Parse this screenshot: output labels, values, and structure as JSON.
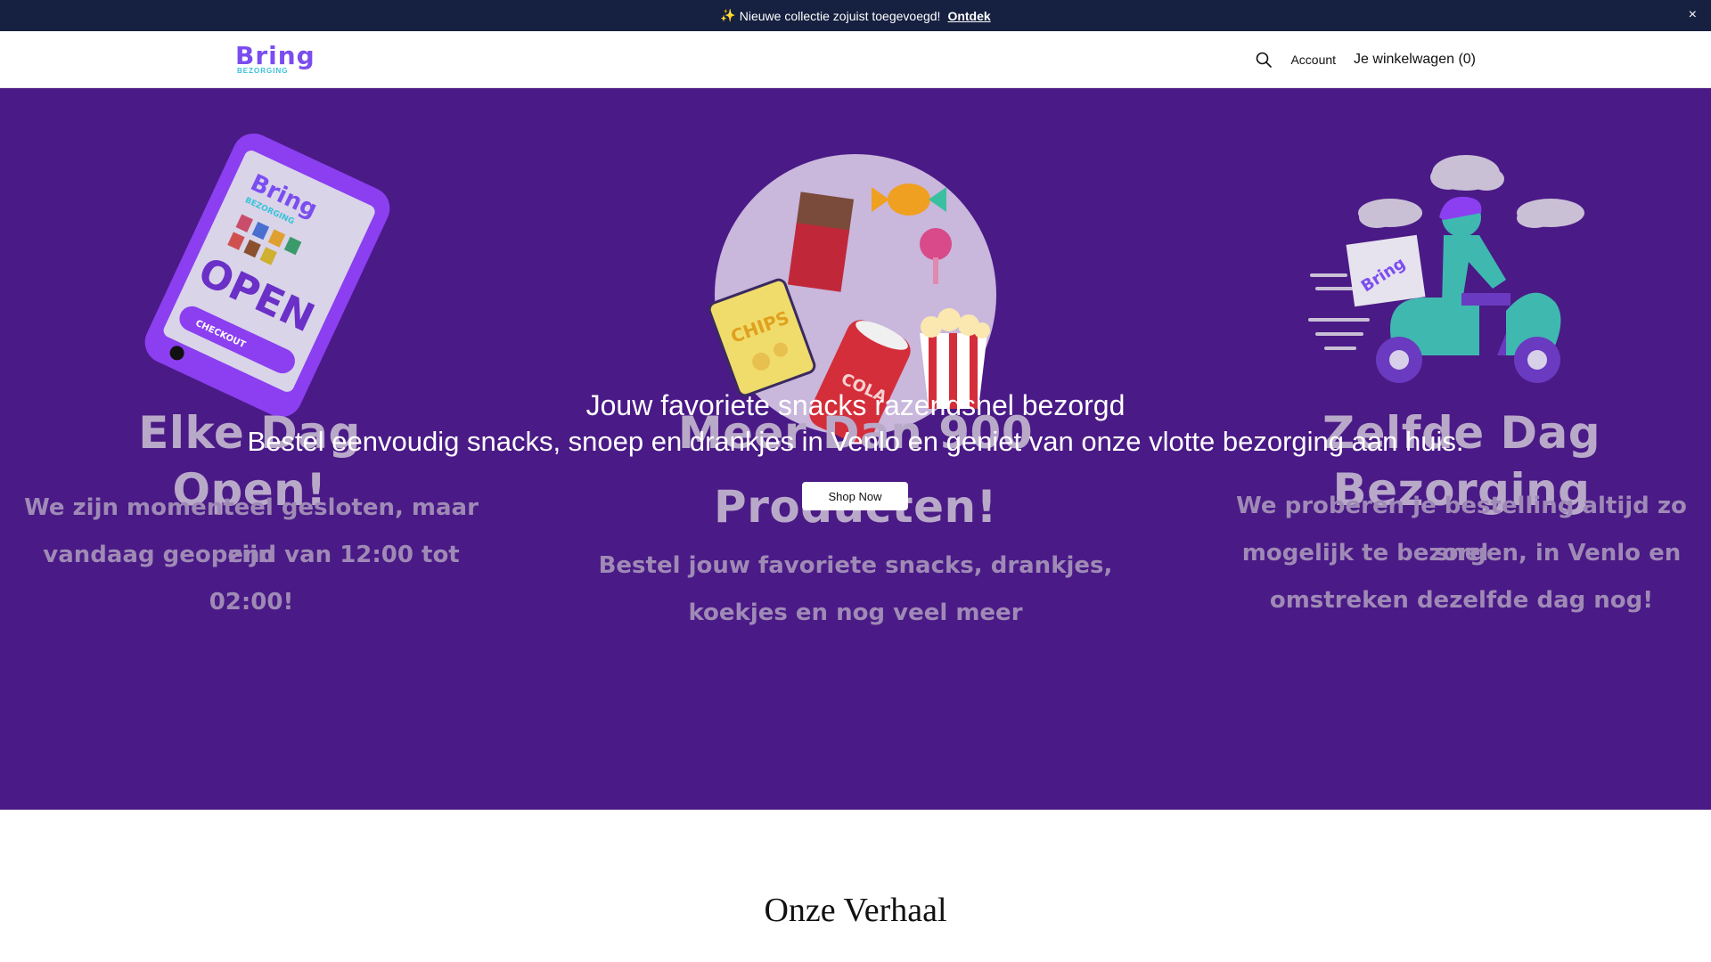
{
  "announcement": {
    "icon": "sparkle-icon",
    "text": "Nieuwe collectie zojuist toegevoegd!",
    "link": "Ontdek",
    "close_glyph": "×"
  },
  "header": {
    "logo_word": "Bring",
    "logo_sub": "BEZORGING",
    "account": "Account",
    "cart": "Je winkelwagen (0)"
  },
  "hero": {
    "heading": "Jouw favoriete snacks razendsnel bezorgd",
    "subheading": "Bestel eenvoudig snacks, snoep en drankjes in Venlo en geniet van onze vlotte bezorging aan huis.",
    "button": "Shop Now",
    "phone_brand": "Bring",
    "phone_brand_sub": "BEZORGING",
    "phone_open": "OPEN",
    "phone_checkout": "CHECKOUT",
    "box_brand": "Bring",
    "chips": "CHIPS",
    "cola": "COLA",
    "features": [
      {
        "title": "Elke Dag Open!",
        "lines": [
          "We zijn momenteel gesloten, maar zijn",
          "vandaag geopend van 12:00 tot 02:00!"
        ]
      },
      {
        "title_lines": [
          "Meer Dan 900",
          "Producten!"
        ],
        "lines": [
          "Bestel jouw favoriete snacks, drankjes,",
          "koekjes en nog veel meer"
        ]
      },
      {
        "title": "Zelfde Dag Bezorging",
        "lines": [
          "We proberen je bestelling altijd zo snel",
          "mogelijk te bezorgen, in Venlo en",
          "omstreken dezelfde dag nog!"
        ]
      }
    ]
  },
  "story": {
    "title": "Onze Verhaal"
  },
  "colors": {
    "hero_bg": "#4a1a86",
    "announce_bg": "#162040",
    "brand_purple": "#7b4df0",
    "brand_teal": "#39c2d9"
  }
}
